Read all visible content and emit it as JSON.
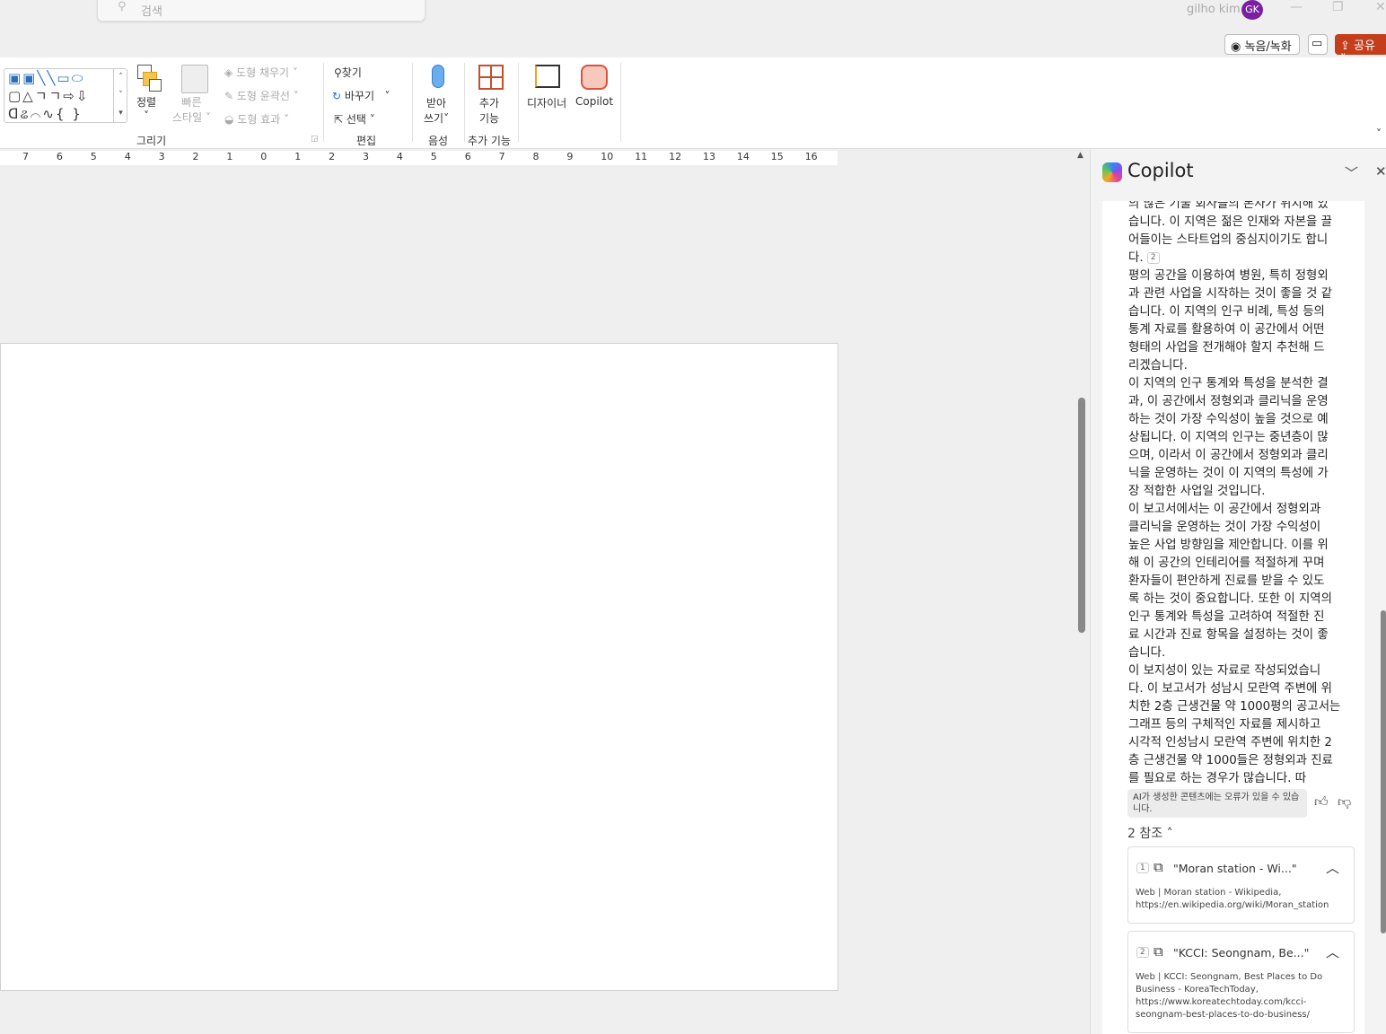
{
  "titlebar": {
    "search_placeholder": "검색",
    "user_name": "gilho kim",
    "avatar_initials": "GK",
    "record_label": "녹음/녹화",
    "share_label": "공유"
  },
  "ribbon": {
    "arrange": "정렬",
    "quick_style_1": "빠른",
    "quick_style_2": "스타일",
    "shape_fill": "도형 채우기",
    "shape_outline": "도형 윤곽선",
    "shape_effects": "도형 효과",
    "find": "찾기",
    "replace": "바꾸기",
    "select": "선택",
    "dictate_1": "받아",
    "dictate_2": "쓰기",
    "addins_1": "추가",
    "addins_2": "기능",
    "designer": "디자이너",
    "copilot": "Copilot",
    "groups": {
      "drawing": "그리기",
      "editing": "편집",
      "voice": "음성",
      "addins": "추가 기능"
    }
  },
  "ruler": [
    "7",
    "6",
    "5",
    "4",
    "3",
    "2",
    "1",
    "0",
    "1",
    "2",
    "3",
    "4",
    "5",
    "6",
    "7",
    "8",
    "9",
    "10",
    "11",
    "12",
    "13",
    "14",
    "15",
    "16"
  ],
  "copilot": {
    "title": "Copilot",
    "lines": [
      [
        "의 많은 기술 회사들의 본사가 위치해 있"
      ],
      [
        "습니다. 이 지역은 젊은 인재와 자본을 끌",
        "어들이는 스타트업의 중심지이기도 합니",
        "다."
      ],
      [
        "평의 공간을 이용하여 병원, 특히 정형외",
        "과 관련 사업을 시작하는 것이 좋을 것 같",
        "습니다. 이 지역의 인구 비례, 특성 등의",
        "통계 자료를 활용하여 이 공간에서 어떤",
        "형태의 사업을 전개해야 할지 추천해 드",
        "리겠습니다."
      ],
      [
        "이 지역의 인구 통계와 특성을 분석한 결",
        "과, 이 공간에서 정형외과 클리닉을 운영",
        "하는 것이 가장 수익성이 높을 것으로 예",
        "상됩니다. 이 지역의 인구는 중년층이 많",
        "으며, 이라서 이 공간에서 정형외과 클리",
        "닉을 운영하는 것이 이 지역의 특성에 가",
        "장 적합한 사업일 것입니다."
      ],
      [
        "이 보고서에서는 이 공간에서 정형외과",
        "클리닉을 운영하는 것이 가장 수익성이",
        "높은 사업 방향임을 제안합니다. 이를 위",
        "해 이 공간의 인테리어를 적절하게 꾸며",
        "환자들이 편안하게 진료를 받을 수 있도",
        "록 하는 것이 중요합니다. 또한 이 지역의",
        "인구 통계와 특성을 고려하여 적절한 진",
        "료 시간과 진료 항목을 설정하는 것이 좋",
        "습니다."
      ],
      [
        "이 보지성이 있는 자료로 작성되었습니",
        "다. 이 보고서가 성남시 모란역 주변에 위",
        "치한 2층 근생건물 약 1000평의 공고서는",
        "그래프 등의 구체적인 자료를 제시하고",
        "시각적 인성남시 모란역 주변에 위치한 2",
        "층 근생건물 약 1000들은 정형외과 진료",
        "를 필요로 하는 경우가 많습니다. 따"
      ]
    ],
    "inline_cite": "2",
    "disclaimer": "AI가 생성한 콘텐츠에는 오류가 있을 수 있습니다.",
    "refs_label": "2 참조",
    "refs": [
      {
        "num": "1",
        "title": "\"Moran station - Wi...\"",
        "source": "Web",
        "desc": "Moran station - Wikipedia, https://en.wikipedia.org/wiki/Moran_station"
      },
      {
        "num": "2",
        "title": "\"KCCI: Seongnam, Be...\"",
        "source": "Web",
        "desc": "KCCI: Seongnam, Best Places to Do Business - KoreaTechToday, https://www.koreatechtoday.com/kcci-seongnam-best-places-to-do-business/"
      }
    ]
  }
}
